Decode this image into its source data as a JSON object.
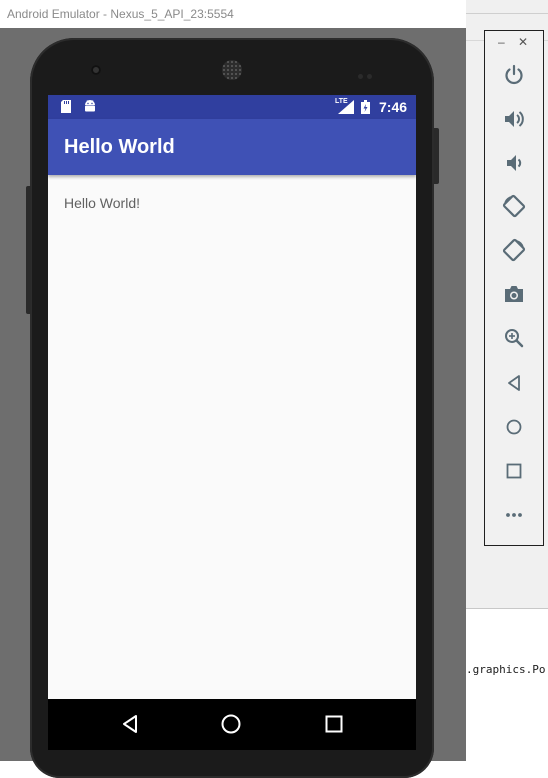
{
  "emulator": {
    "window_title": "Android Emulator - Nexus_5_API_23:5554"
  },
  "status_bar": {
    "network_label": "LTE",
    "time": "7:46",
    "icons": [
      "sd-card-icon",
      "android-icon",
      "signal-icon",
      "battery-icon"
    ]
  },
  "app": {
    "title": "Hello World",
    "content_text": "Hello World!"
  },
  "nav_bar": {
    "buttons": [
      "back-icon",
      "home-icon",
      "recents-icon"
    ]
  },
  "side_panel": {
    "minimize_label": "–",
    "close_label": "✕",
    "buttons": [
      "power-icon",
      "volume-up-icon",
      "volume-down-icon",
      "rotate-left-icon",
      "rotate-right-icon",
      "camera-icon",
      "zoom-icon",
      "back-icon",
      "home-icon",
      "overview-icon",
      "more-icon"
    ]
  },
  "ide": {
    "code_fragment": ".graphics.Po"
  },
  "colors": {
    "status_bar": "#303f9f",
    "app_bar": "#3f51b5",
    "screen_bg": "#fafafa",
    "panel_icon": "#5a6c77"
  }
}
